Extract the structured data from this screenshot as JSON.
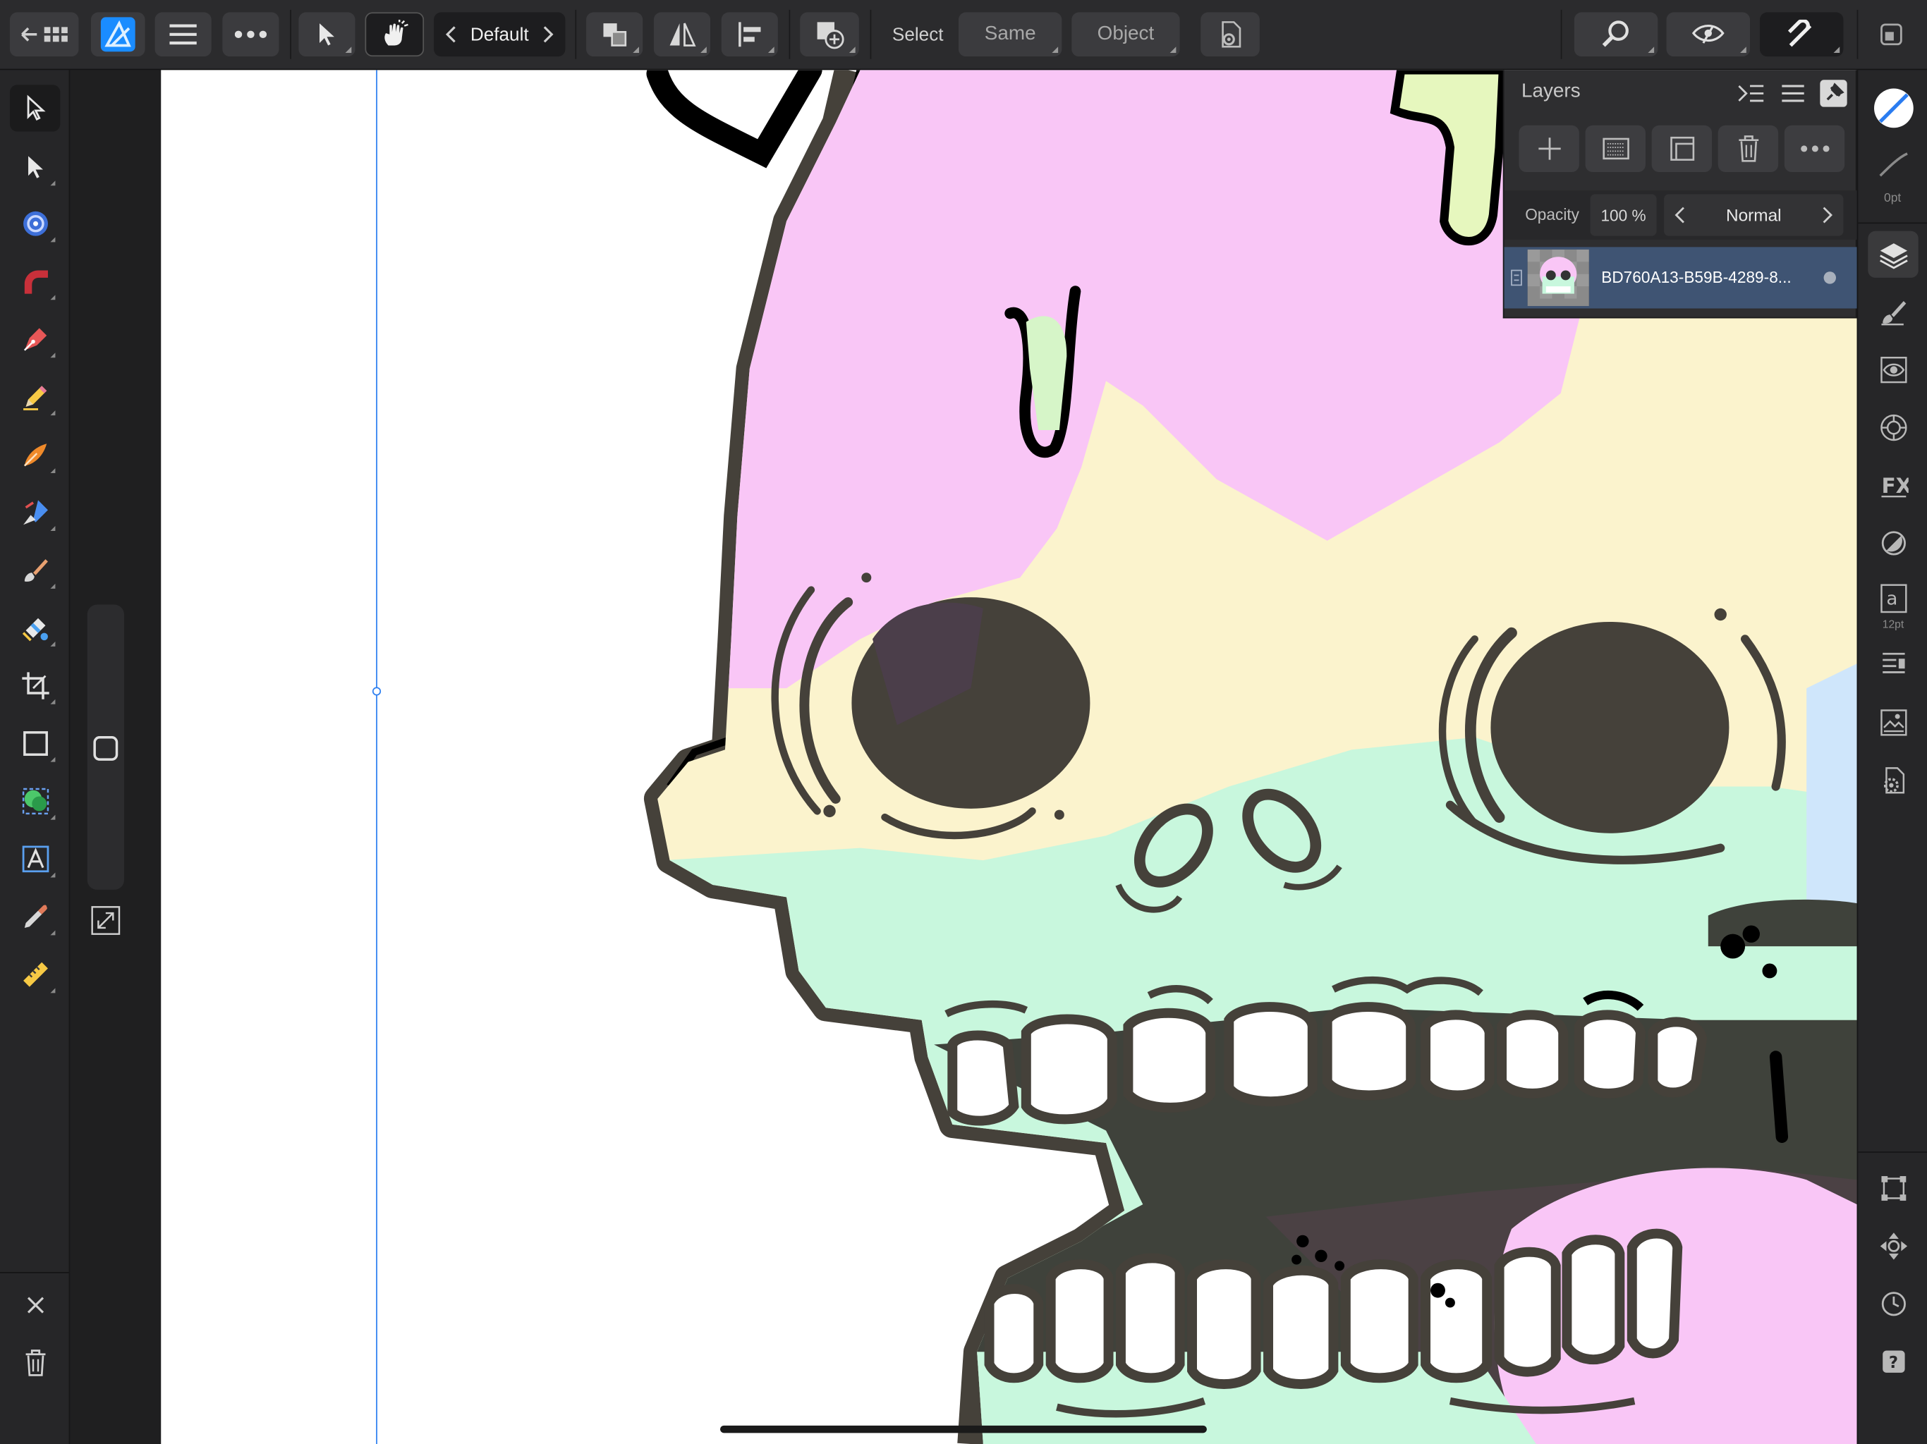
{
  "toolbar": {
    "style_preset": "Default",
    "select_label": "Select",
    "same_label": "Same",
    "object_label": "Object",
    "icons": [
      "back-arrow-icon",
      "grid-icon",
      "affinity-designer-logo",
      "menu-icon",
      "more-icon",
      "move-tool-icon",
      "gesture-hand-icon",
      "chevron-left-icon",
      "chevron-right-icon",
      "arrange-icon",
      "flip-icon",
      "align-icon",
      "add-shape-icon",
      "select-settings-icon",
      "zoom-search-icon",
      "view-mode-icon",
      "snapping-magnet-icon",
      "export-persona-icon"
    ]
  },
  "left_tools": [
    "move-tool-icon",
    "node-tool-icon",
    "corner-tool-icon",
    "point-transform-tool-icon",
    "pen-tool-icon",
    "pencil-tool-icon",
    "vector-brush-tool-icon",
    "fill-tool-icon",
    "paint-brush-tool-icon",
    "transparency-tool-icon",
    "vector-crop-tool-icon",
    "crop-tool-icon",
    "rectangle-tool-icon",
    "shape-builder-tool-icon",
    "artistic-text-tool-icon",
    "color-picker-tool-icon",
    "measure-tool-icon",
    "close-icon",
    "trash-icon"
  ],
  "right_tools": {
    "stroke_width_label": "0pt",
    "font_size_label": "12pt",
    "icons": [
      "fill-stroke-swatch-icon",
      "stroke-studio-icon",
      "layers-studio-icon",
      "brushes-studio-icon",
      "appearance-studio-icon",
      "color-studio-icon",
      "fx-studio-icon",
      "transparency-studio-icon",
      "text-studio-icon",
      "stock-studio-icon",
      "assets-studio-icon",
      "settings-studio-icon",
      "transform-studio-icon",
      "navigator-studio-icon",
      "history-studio-icon",
      "help-icon"
    ]
  },
  "layers": {
    "title": "Layers",
    "opacity_label": "Opacity",
    "opacity_value": "100 %",
    "blend_mode": "Normal",
    "items": [
      {
        "name": "BD760A13-B59B-4289-8...",
        "selected": true
      }
    ]
  },
  "colors": {
    "accent_blue": "#1a8cff",
    "layer_selected": "#3f5473",
    "canvas_pink": "#f9c6f6",
    "canvas_cream": "#fbf3cd",
    "canvas_mint": "#c8f7dd",
    "canvas_dark": "#45413a"
  }
}
